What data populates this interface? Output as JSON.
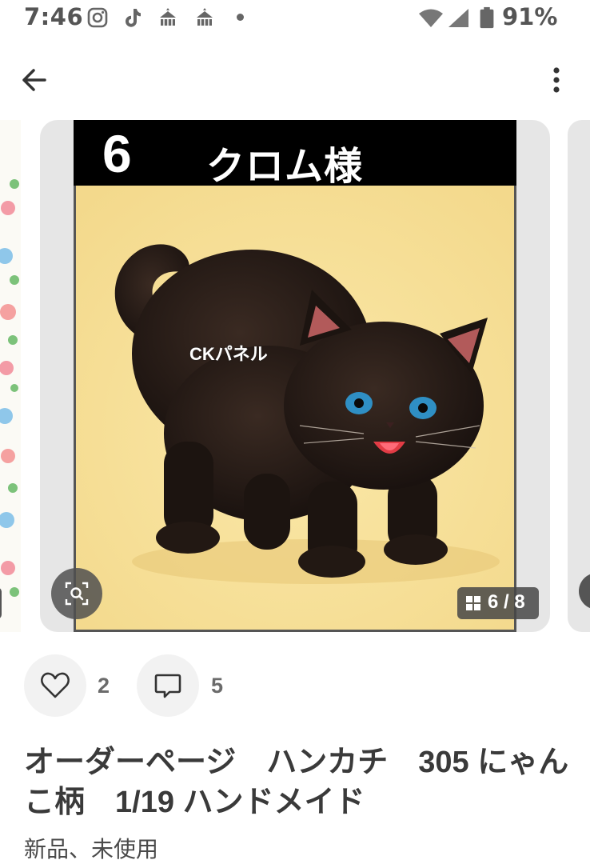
{
  "status_bar": {
    "time": "7:46",
    "notification_icons": [
      "instagram-icon",
      "tiktok-icon",
      "tent-icon",
      "tent-icon"
    ],
    "battery": "91%"
  },
  "app_bar": {
    "back_icon": "arrow-left-icon",
    "menu_icon": "more-vertical-icon"
  },
  "gallery": {
    "banner_number": "6",
    "banner_name": "クロム様",
    "watermark": "CKパネル",
    "counter": "6 / 8",
    "current_index": 6,
    "total": 8,
    "background_color": "#f7e09a"
  },
  "actions": {
    "like_count": "2",
    "comment_count": "5"
  },
  "item": {
    "title": "オーダーページ　ハンカチ　305 にゃんこ柄　1/19 ハンドメイド",
    "condition": "新品、未使用"
  }
}
